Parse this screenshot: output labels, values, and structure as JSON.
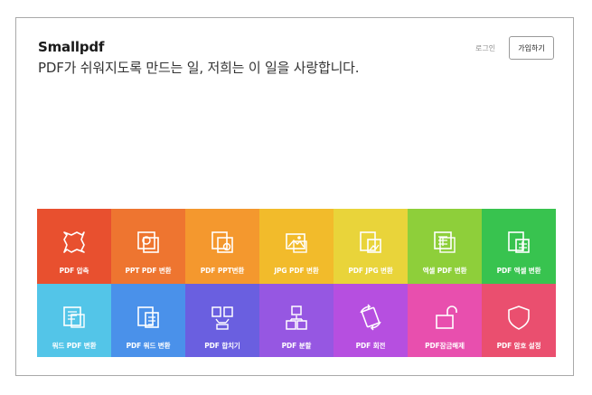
{
  "header": {
    "brand": "Smallpdf",
    "tagline": "PDF가 쉬워지도록 만드는 일, 저희는 이 일을 사랑합니다.",
    "login_label": "로그인",
    "signup_label": "가입하기"
  },
  "tools": [
    {
      "label": "PDF 압축",
      "color": "#e8502f",
      "icon": "compress-icon"
    },
    {
      "label": "PPT PDF 변환",
      "color": "#ee7530",
      "icon": "ppt-to-pdf-icon"
    },
    {
      "label": "PDF PPT변환",
      "color": "#f4982e",
      "icon": "pdf-to-ppt-icon"
    },
    {
      "label": "JPG PDF 변환",
      "color": "#f2bb2b",
      "icon": "jpg-to-pdf-icon"
    },
    {
      "label": "PDF JPG 변환",
      "color": "#e9d43a",
      "icon": "pdf-to-jpg-icon"
    },
    {
      "label": "엑셀 PDF 변환",
      "color": "#8ecf3a",
      "icon": "excel-to-pdf-icon"
    },
    {
      "label": "PDF 엑셀 변환",
      "color": "#38c34f",
      "icon": "pdf-to-excel-icon"
    },
    {
      "label": "워드 PDF 변환",
      "color": "#53c5e8",
      "icon": "word-to-pdf-icon"
    },
    {
      "label": "PDF 워드 변환",
      "color": "#4a91ea",
      "icon": "pdf-to-word-icon"
    },
    {
      "label": "PDF 합치기",
      "color": "#6a5fe0",
      "icon": "merge-icon"
    },
    {
      "label": "PDF 분할",
      "color": "#9657e2",
      "icon": "split-icon"
    },
    {
      "label": "PDF 회전",
      "color": "#b64fe0",
      "icon": "rotate-icon"
    },
    {
      "label": "PDF잠금해제",
      "color": "#e84fae",
      "icon": "unlock-icon"
    },
    {
      "label": "PDF 암호 설정",
      "color": "#ea4f6f",
      "icon": "protect-icon"
    }
  ]
}
